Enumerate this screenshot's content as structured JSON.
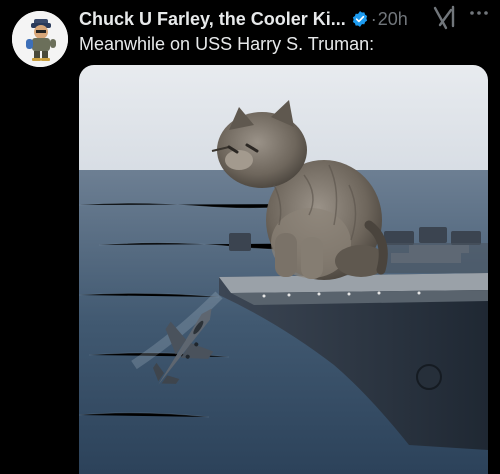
{
  "tweet": {
    "author_name": "Chuck U Farley, the Cooler Ki...",
    "separator": "·",
    "time": "20h",
    "text": "Meanwhile on USS Harry S. Truman:"
  },
  "colors": {
    "background": "#000000",
    "verified_badge": "#1d9bf0",
    "secondary_text": "#71767b",
    "primary_text": "#e7e9ea"
  },
  "icons": {
    "verified": "verified-badge-icon",
    "grok": "grok-icon",
    "more": "more-horizontal-icon"
  }
}
